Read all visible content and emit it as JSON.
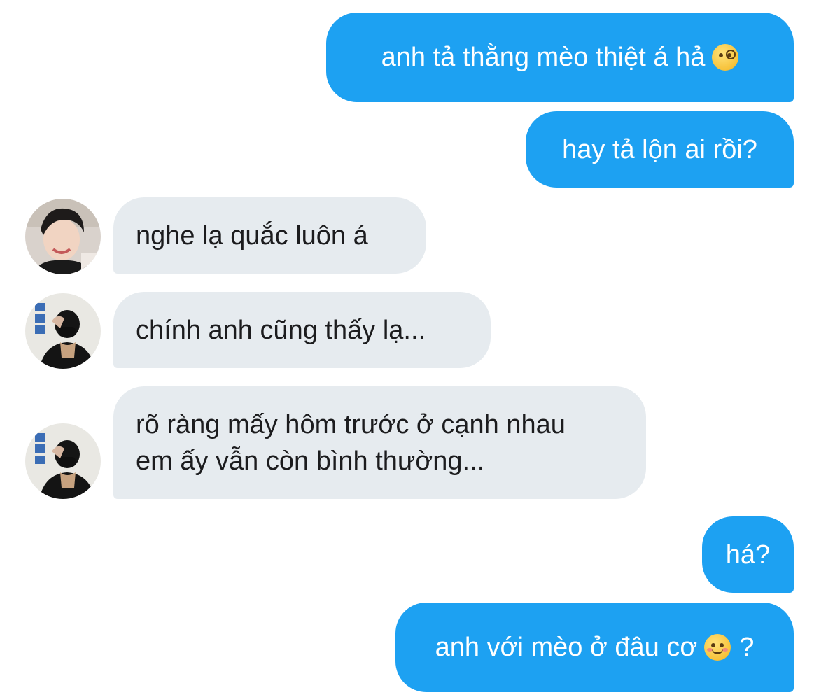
{
  "messages": [
    {
      "from": "me",
      "text": "anh tả thằng mèo thiệt á hả",
      "emoji": "face-with-monocle-icon"
    },
    {
      "from": "me",
      "text": "hay tả lộn ai rồi?"
    },
    {
      "from": "them",
      "text": "nghe lạ quắc luôn á"
    },
    {
      "from": "them",
      "text": "chính anh cũng thấy lạ..."
    },
    {
      "from": "them",
      "line1": "rõ ràng mấy hôm trước ở cạnh nhau",
      "line2": "em ấy vẫn còn bình thường..."
    },
    {
      "from": "me",
      "text": "há?"
    },
    {
      "from": "me",
      "text_before": "anh với mèo ở đâu cơ",
      "emoji": "smiling-face-icon",
      "text_after": "?"
    }
  ],
  "colors": {
    "outgoing_bubble": "#1da1f2",
    "incoming_bubble": "#e6ebef",
    "incoming_text": "#1c1c1e",
    "outgoing_text": "#ffffff"
  }
}
